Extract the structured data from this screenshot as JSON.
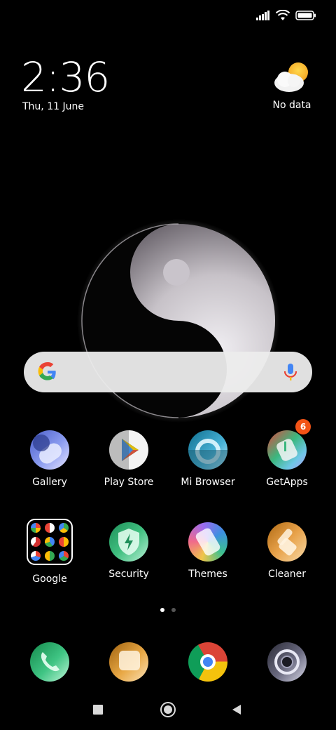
{
  "status_bar": {
    "icons": [
      "signal-icon",
      "wifi-icon",
      "battery-icon"
    ]
  },
  "clock": {
    "time": "2:36",
    "date": "Thu, 11 June"
  },
  "weather": {
    "icon": "partly-cloudy-icon",
    "label": "No data"
  },
  "search_bar": {
    "logo": "google-g-icon",
    "mic": "microphone-icon"
  },
  "apps_row1": [
    {
      "label": "Gallery",
      "icon": "gallery-icon"
    },
    {
      "label": "Play Store",
      "icon": "play-store-icon"
    },
    {
      "label": "Mi Browser",
      "icon": "mi-browser-icon"
    },
    {
      "label": "GetApps",
      "icon": "getapps-icon",
      "badge": "6"
    }
  ],
  "apps_row2": [
    {
      "label": "Google",
      "icon": "google-folder-icon"
    },
    {
      "label": "Security",
      "icon": "security-icon"
    },
    {
      "label": "Themes",
      "icon": "themes-icon"
    },
    {
      "label": "Cleaner",
      "icon": "cleaner-icon"
    }
  ],
  "page_indicator": {
    "pages": 2,
    "active": 1
  },
  "dock": [
    "phone-icon",
    "messages-icon",
    "chrome-icon",
    "camera-icon"
  ],
  "nav_bar": [
    "recents-button",
    "home-button",
    "back-button"
  ],
  "colors": {
    "badge": "#f25316",
    "search_bg": "#ececec"
  }
}
